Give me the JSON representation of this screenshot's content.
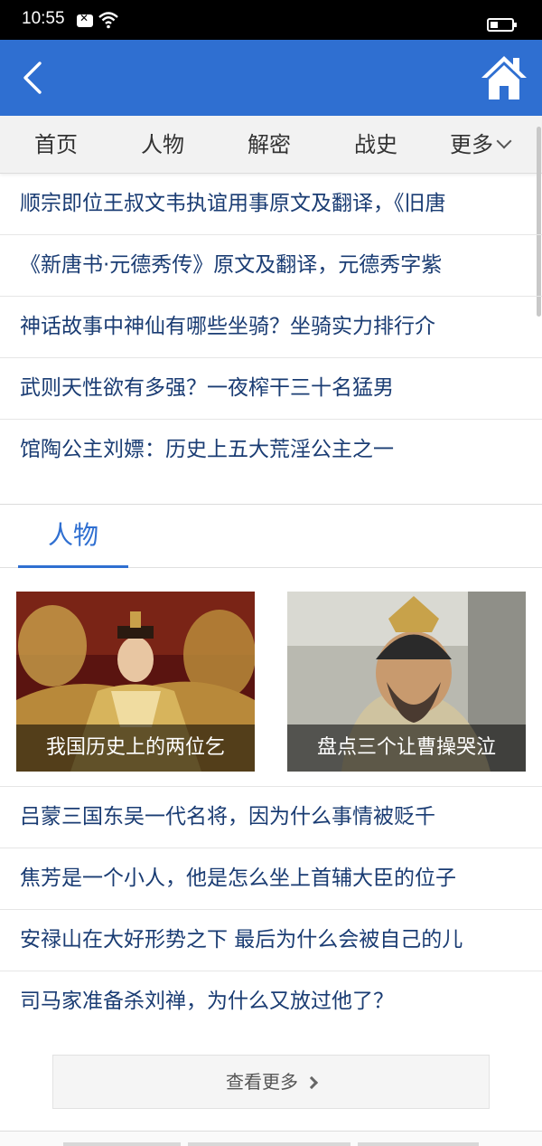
{
  "status_bar": {
    "time": "10:55"
  },
  "header": {
    "back_icon": "chevron-left-icon",
    "home_icon": "home-icon",
    "color": "#2f6fd1"
  },
  "nav": {
    "tabs": [
      {
        "label": "首页"
      },
      {
        "label": "人物"
      },
      {
        "label": "解密"
      },
      {
        "label": "战史"
      },
      {
        "label": "更多"
      }
    ]
  },
  "articles_top": [
    "顺宗即位王叔文韦执谊用事原文及翻译，《旧唐",
    "《新唐书·元德秀传》原文及翻译，元德秀字紫",
    "神话故事中神仙有哪些坐骑？坐骑实力排行介",
    "武则天性欲有多强？一夜榨干三十名猛男",
    "馆陶公主刘嫖：历史上五大荒淫公主之一"
  ],
  "section": {
    "title": "人物"
  },
  "cards": [
    {
      "caption": "我国历史上的两位乞"
    },
    {
      "caption": "盘点三个让曹操哭泣"
    }
  ],
  "articles_bottom": [
    "吕蒙三国东吴一代名将，因为什么事情被贬千",
    "焦芳是一个小人，他是怎么坐上首辅大臣的位子",
    "安禄山在大好形势之下 最后为什么会被自己的儿",
    "司马家准备杀刘禅，为什么又放过他了？"
  ],
  "more_button": {
    "label": "查看更多"
  },
  "colors": {
    "accent": "#2f6fd1",
    "link": "#1a3c73"
  }
}
